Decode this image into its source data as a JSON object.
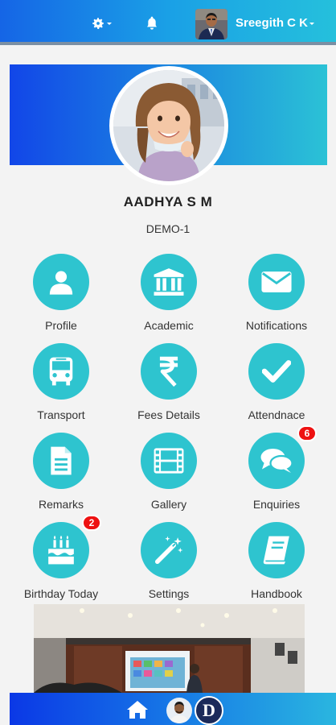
{
  "topbar": {
    "settings_icon": "gear-icon",
    "notification_icon": "bell-icon",
    "username": "Sreegith C K"
  },
  "profile": {
    "name": "AADHYA S M",
    "class": "DEMO-1"
  },
  "menu": [
    {
      "label": "Profile",
      "icon": "user-icon"
    },
    {
      "label": "Academic",
      "icon": "institution-icon"
    },
    {
      "label": "Notifications",
      "icon": "envelope-icon"
    },
    {
      "label": "Transport",
      "icon": "bus-icon"
    },
    {
      "label": "Fees Details",
      "icon": "rupee-icon"
    },
    {
      "label": "Attendnace",
      "icon": "check-icon"
    },
    {
      "label": "Remarks",
      "icon": "document-icon"
    },
    {
      "label": "Gallery",
      "icon": "film-icon"
    },
    {
      "label": "Enquiries",
      "icon": "chat-icon",
      "badge": "6"
    },
    {
      "label": "Birthday Today",
      "icon": "birthday-cake-icon",
      "badge": "2"
    },
    {
      "label": "Settings",
      "icon": "magic-wand-icon"
    },
    {
      "label": "Handbook",
      "icon": "book-icon"
    }
  ],
  "bottombar": {
    "home_icon": "home-icon",
    "logo_letter": "D"
  },
  "colors": {
    "accent": "#2ec4cf",
    "badge": "#ee1111",
    "header_start": "#1565e6",
    "header_end": "#25c0dc"
  }
}
